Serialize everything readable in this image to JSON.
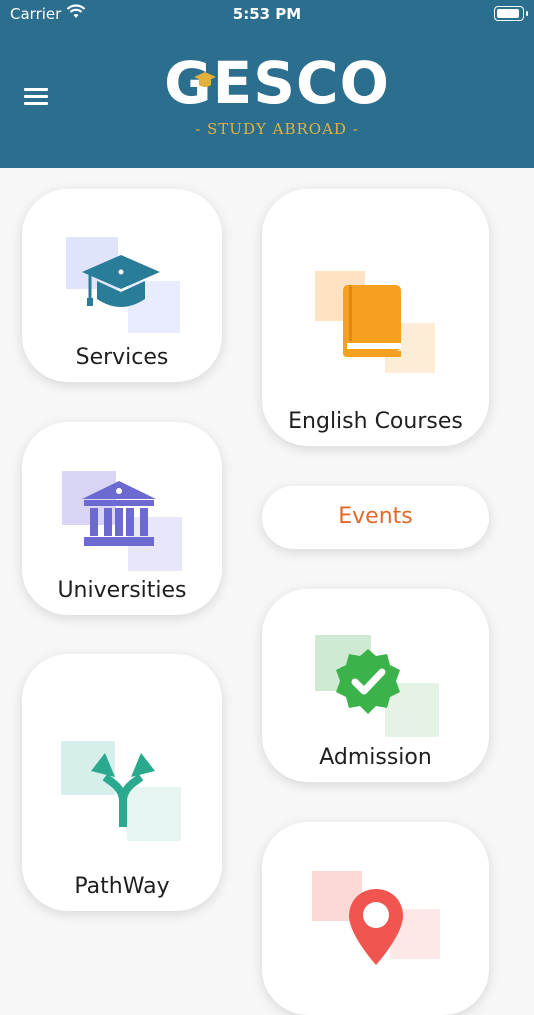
{
  "status_bar": {
    "carrier": "Carrier",
    "time": "5:53 PM"
  },
  "header": {
    "logo_text": "GESCO",
    "logo_subtitle": "- STUDY ABROAD -",
    "background": "#2c6e8e",
    "subtitle_color": "#e3b13b"
  },
  "menu": {
    "services": {
      "label": "Services",
      "icon": "graduation-cap-icon",
      "color": "#2a7d98"
    },
    "english_courses": {
      "label": "English Courses",
      "icon": "book-icon",
      "color": "#f5a021"
    },
    "universities": {
      "label": "Universities",
      "icon": "university-building-icon",
      "color": "#6c6ad0"
    },
    "events": {
      "label": "Events",
      "color": "#e0692c"
    },
    "admission": {
      "label": "Admission",
      "icon": "verified-check-icon",
      "color": "#3bb34a"
    },
    "pathway": {
      "label": "PathWay",
      "icon": "split-arrows-icon",
      "color": "#2aa98f"
    },
    "location": {
      "label": "",
      "icon": "location-pin-icon",
      "color": "#f0554f"
    }
  }
}
